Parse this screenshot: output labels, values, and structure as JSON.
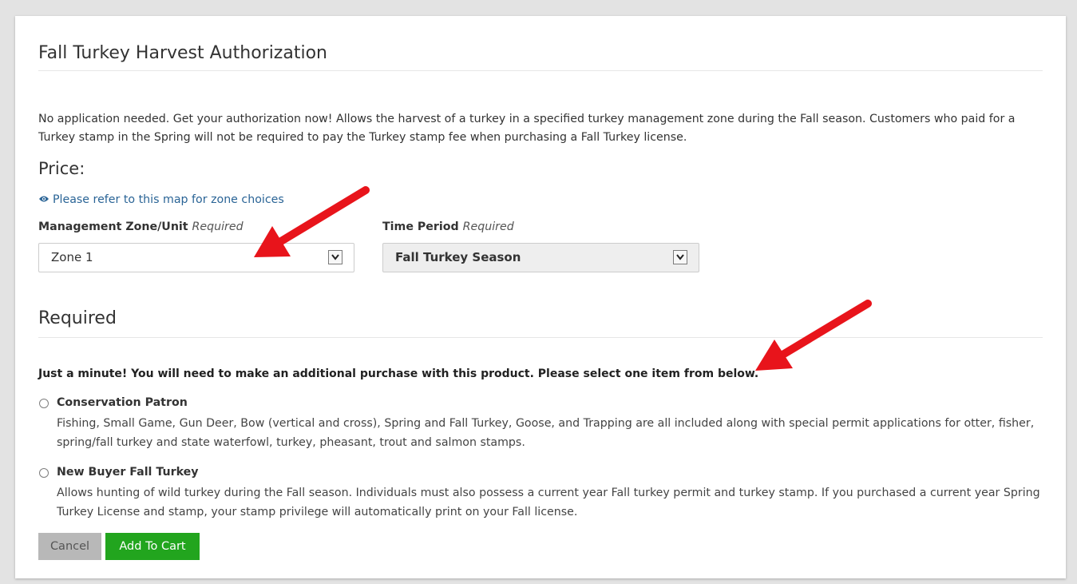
{
  "page": {
    "title": "Fall Turkey Harvest Authorization",
    "description": "No application needed. Get your authorization now! Allows the harvest of a turkey in a specified turkey management zone during the Fall season. Customers who paid for a Turkey stamp in the Spring will not be required to pay the Turkey stamp fee when purchasing a Fall Turkey license.",
    "price_label": "Price:",
    "map_link": "Please refer to this map for zone choices"
  },
  "fields": {
    "zone": {
      "label": "Management Zone/Unit",
      "required_text": "Required",
      "value": "Zone 1"
    },
    "period": {
      "label": "Time Period",
      "required_text": "Required",
      "value": "Fall Turkey Season"
    }
  },
  "required_section": {
    "title": "Required",
    "notice": "Just a minute!  You will need to make an additional purchase with this product.  Please select one item from below.",
    "options": [
      {
        "title": "Conservation Patron",
        "description": "Fishing, Small Game, Gun Deer, Bow (vertical and cross), Spring and Fall Turkey, Goose, and Trapping are all included along with special permit applications for otter, fisher, spring/fall turkey and state waterfowl, turkey, pheasant, trout and salmon stamps."
      },
      {
        "title": "New Buyer Fall Turkey",
        "description": "Allows hunting of wild turkey during the Fall season. Individuals must also possess a current year Fall turkey permit and turkey stamp. If you purchased a current year Spring Turkey License and stamp, your stamp privilege will automatically print on your Fall license."
      }
    ]
  },
  "buttons": {
    "cancel": "Cancel",
    "add_to_cart": "Add To Cart"
  },
  "colors": {
    "link": "#2a6496",
    "add_button": "#22a51e",
    "cancel_button": "#b8b8b8",
    "annotation_arrow": "#e8141b"
  },
  "icons": {
    "map_link": "eye-icon",
    "select": "chevron-down-icon",
    "annotation": "red-arrow-icon"
  }
}
